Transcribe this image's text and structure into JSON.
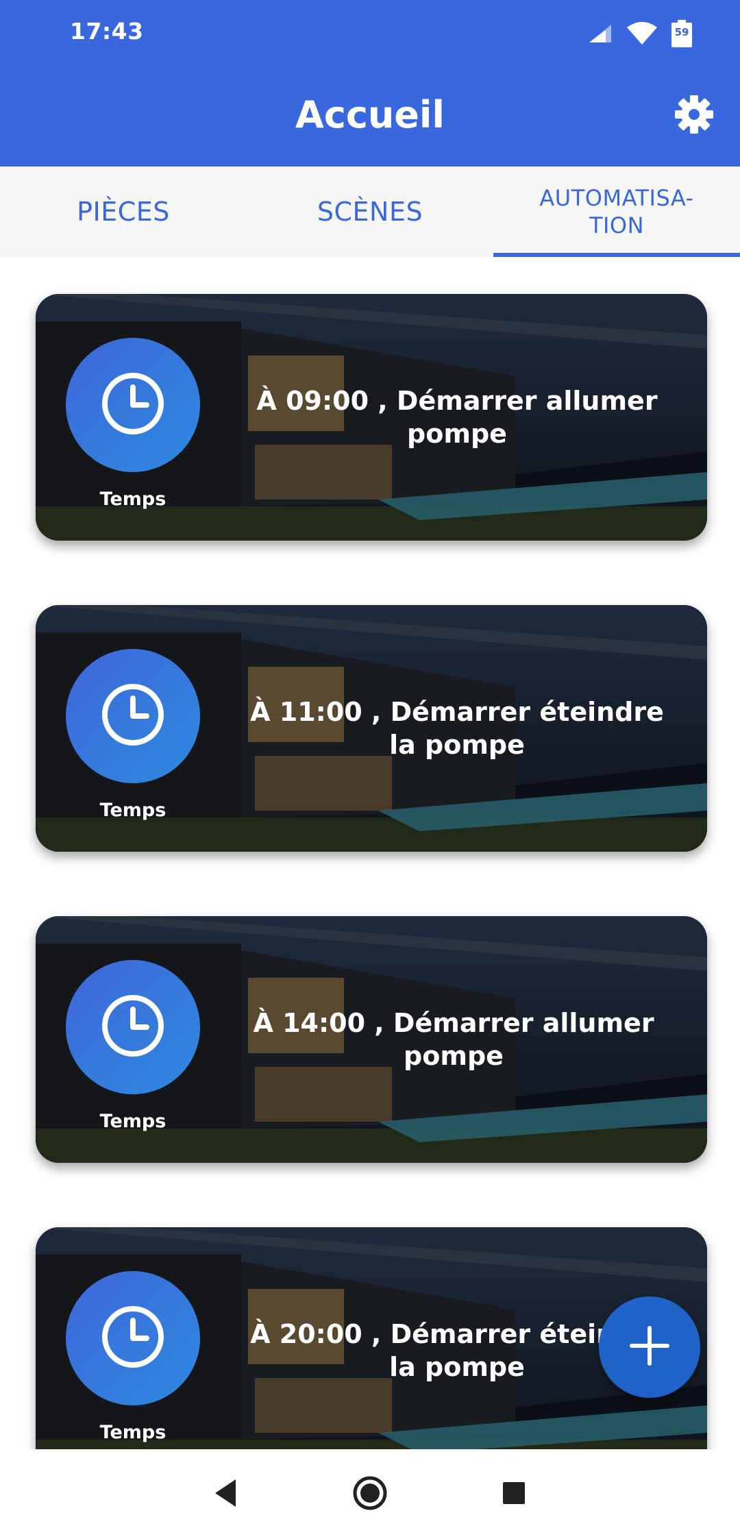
{
  "status_bar": {
    "time": "17:43",
    "battery": "59",
    "icons": [
      "signal-icon",
      "wifi-icon",
      "battery-icon"
    ]
  },
  "header": {
    "title": "Accueil",
    "settings_icon": "gear-icon"
  },
  "tabs": [
    {
      "label": "PIÈCES",
      "selected": false
    },
    {
      "label": "SCÈNES",
      "selected": false
    },
    {
      "label": "AUTOMATISA-\nTION",
      "selected": true
    }
  ],
  "automations": [
    {
      "trigger": "Temps",
      "icon": "clock-icon",
      "title": "À 09:00 , Démarrer allumer pompe"
    },
    {
      "trigger": "Temps",
      "icon": "clock-icon",
      "title": "À 11:00 , Démarrer éteindre la pompe"
    },
    {
      "trigger": "Temps",
      "icon": "clock-icon",
      "title": "À 14:00 , Démarrer allumer pompe"
    },
    {
      "trigger": "Temps",
      "icon": "clock-icon",
      "title": "À 20:00 , Démarrer éteindre la pompe"
    }
  ],
  "fab": {
    "icon": "plus-icon"
  },
  "navigation": {
    "icons": [
      "back-icon",
      "home-icon",
      "recents-icon"
    ]
  },
  "colors": {
    "primary": "#3967dd",
    "tab_background": "#f6f6f6",
    "fab": "#1f63c8"
  }
}
